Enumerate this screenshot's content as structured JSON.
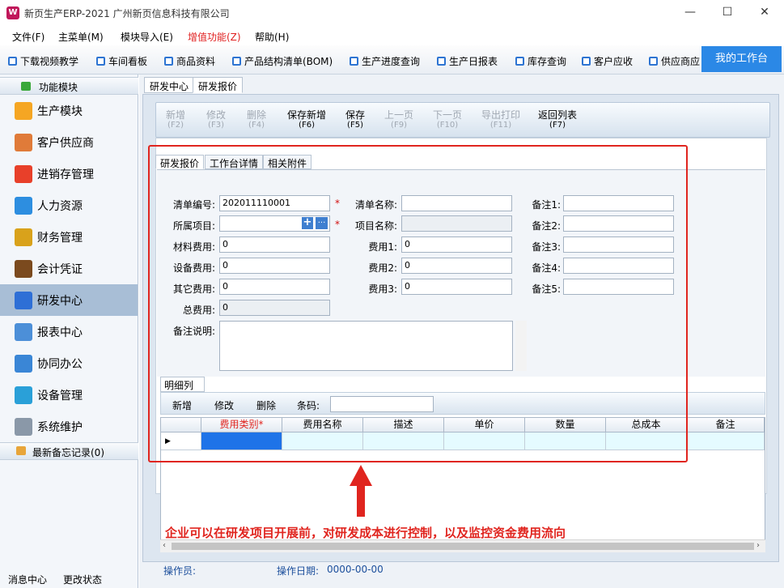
{
  "window": {
    "title": "新页生产ERP-2021 广州新页信息科技有限公司",
    "icon_label": "W",
    "min_icon": "minimize-icon",
    "max_icon": "maximize-icon",
    "close_icon": "close-icon"
  },
  "menubar": [
    {
      "label": "文件(F)"
    },
    {
      "label": "主菜单(M)"
    },
    {
      "label": "模块导入(E)"
    },
    {
      "label": "增值功能(Z)",
      "color": "#e02020"
    },
    {
      "label": "帮助(H)"
    }
  ],
  "toolbar": {
    "items": [
      "下载视频教学",
      "车间看板",
      "商品资料",
      "产品结构清单(BOM)",
      "生产进度查询",
      "生产日报表",
      "库存查询",
      "客户应收",
      "供应商应"
    ],
    "workbench": "我的工作台"
  },
  "sidebar": {
    "header": "功能模块",
    "items": [
      {
        "label": "生产模块",
        "icon": "folder-icon",
        "color": "#f5a623"
      },
      {
        "label": "客户供应商",
        "icon": "people-icon",
        "color": "#e07b39"
      },
      {
        "label": "进销存管理",
        "icon": "bar-chart-icon",
        "color": "#e8402a"
      },
      {
        "label": "人力资源",
        "icon": "person-icon",
        "color": "#2d8ee0"
      },
      {
        "label": "财务管理",
        "icon": "coins-icon",
        "color": "#d9a21b"
      },
      {
        "label": "会计凭证",
        "icon": "book-icon",
        "color": "#7b4a1e"
      },
      {
        "label": "研发中心",
        "icon": "chart-line-icon",
        "color": "#2e6fd6"
      },
      {
        "label": "报表中心",
        "icon": "report-icon",
        "color": "#4c8fd8"
      },
      {
        "label": "协同办公",
        "icon": "calendar-icon",
        "color": "#3a86d6"
      },
      {
        "label": "设备管理",
        "icon": "device-icon",
        "color": "#2aa0d8"
      },
      {
        "label": "系统维护",
        "icon": "lock-icon",
        "color": "#8a98a8"
      }
    ],
    "active_index": 6,
    "memo": "最新备忘记录(0)",
    "status_left": "消息中心",
    "status_right": "更改状态"
  },
  "outer_tabs": [
    "研发中心",
    "研发报价"
  ],
  "actions": [
    {
      "label": "新增",
      "key": "(F2)",
      "enabled": false
    },
    {
      "label": "修改",
      "key": "(F3)",
      "enabled": false
    },
    {
      "label": "删除",
      "key": "(F4)",
      "enabled": false
    },
    {
      "label": "保存新增",
      "key": "(F6)",
      "enabled": true
    },
    {
      "label": "保存",
      "key": "(F5)",
      "enabled": true
    },
    {
      "label": "上一页",
      "key": "(F9)",
      "enabled": false
    },
    {
      "label": "下一页",
      "key": "(F10)",
      "enabled": false
    },
    {
      "label": "导出打印",
      "key": "(F11)",
      "enabled": false
    },
    {
      "label": "返回列表",
      "key": "(F7)",
      "enabled": true
    }
  ],
  "inner_tabs": [
    "研发报价",
    "工作台详情",
    "相关附件"
  ],
  "form": {
    "list_no_label": "清单编号:",
    "list_no_value": "202011110001",
    "project_label": "所属项目:",
    "project_value": "",
    "material_label": "材料费用:",
    "material_value": "0",
    "equipment_label": "设备费用:",
    "equipment_value": "0",
    "other_label": "其它费用:",
    "other_value": "0",
    "total_label": "总费用:",
    "total_value": "0",
    "remark_label": "备注说明:",
    "remark_value": "",
    "list_name_label": "清单名称:",
    "list_name_value": "",
    "project_name_label": "项目名称:",
    "project_name_value": "",
    "fee1_label": "费用1:",
    "fee1_value": "0",
    "fee2_label": "费用2:",
    "fee2_value": "0",
    "fee3_label": "费用3:",
    "fee3_value": "0",
    "note1_label": "备注1:",
    "note2_label": "备注2:",
    "note3_label": "备注3:",
    "note4_label": "备注4:",
    "note5_label": "备注5:",
    "required_mark": "*",
    "add_icon_label": "+",
    "more_icon_label": "..."
  },
  "detail": {
    "tab": "明细列表",
    "buttons": [
      "新增",
      "修改",
      "删除"
    ],
    "barcode_label": "条码:",
    "barcode_value": "",
    "columns": [
      "费用类别*",
      "费用名称",
      "描述",
      "单价",
      "数量",
      "总成本",
      "备注"
    ]
  },
  "annotation": "企业可以在研发项目开展前，对研发成本进行控制，以及监控资金费用流向",
  "footer": {
    "operator_label": "操作员:",
    "operator_value": "",
    "date_label": "操作日期:",
    "date_value": "0000-00-00"
  }
}
